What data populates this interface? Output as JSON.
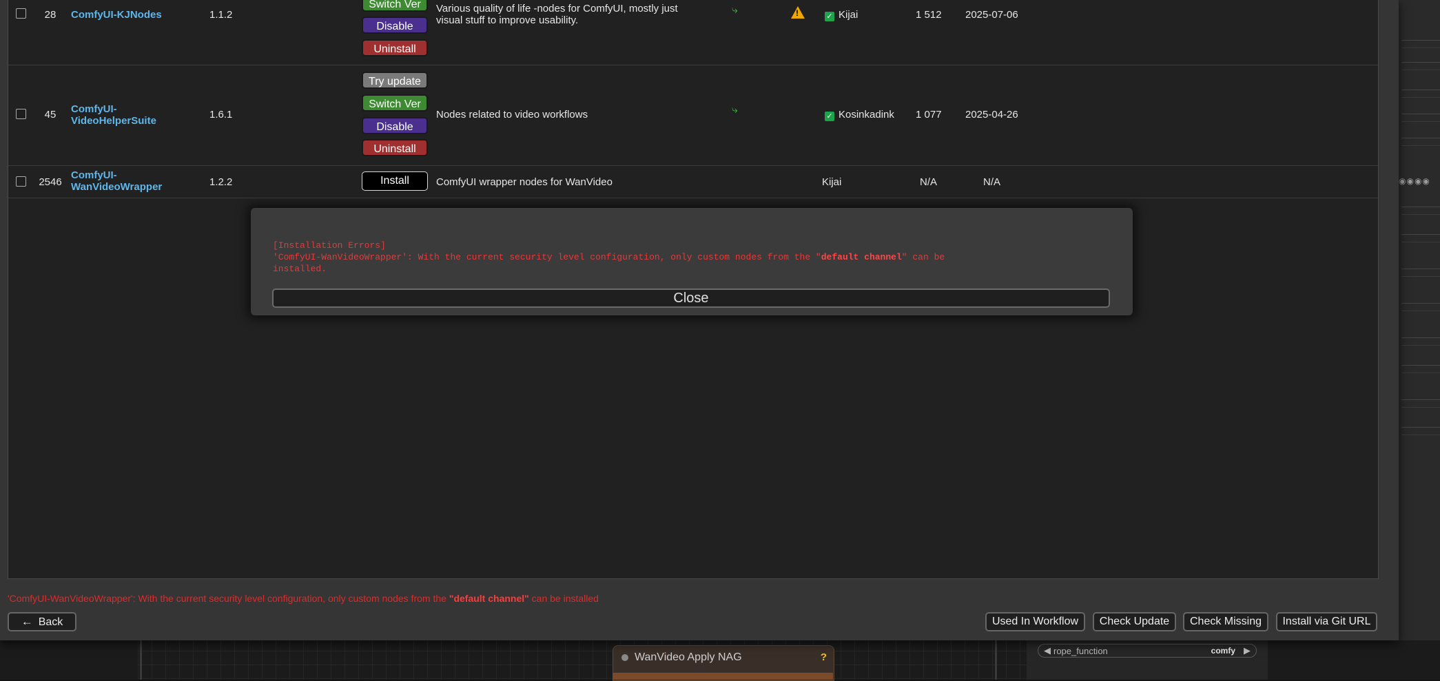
{
  "rows": [
    {
      "id": "28",
      "title": "ComfyUI-KJNodes",
      "version": "1.1.2",
      "buttons": [
        "Switch Ver",
        "Disable",
        "Uninstall"
      ],
      "description": "Various quality of life -nodes for ComfyUI, mostly just visual stuff to improve usability.",
      "author": "Kijai",
      "stars": "1 512",
      "updated": "2025-07-06"
    },
    {
      "id": "45",
      "title": "ComfyUI-VideoHelperSuite",
      "title_line1": "ComfyUI-",
      "title_line2": "VideoHelperSuite",
      "version": "1.6.1",
      "buttons": [
        "Try update",
        "Switch Ver",
        "Disable",
        "Uninstall"
      ],
      "description": "Nodes related to video workflows",
      "author": "Kosinkadink",
      "stars": "1 077",
      "updated": "2025-04-26"
    },
    {
      "id": "2546",
      "title_line1": "ComfyUI-",
      "title_line2": "WanVideoWrapper",
      "version": "1.2.2",
      "buttons": [
        "Install"
      ],
      "description": "ComfyUI wrapper nodes for WanVideo",
      "author": "Kijai",
      "stars": "N/A",
      "updated": "N/A"
    }
  ],
  "dialog": {
    "heading": "[Installation Errors]",
    "line_prefix": "'ComfyUI-WanVideoWrapper': With the current security level configuration, only custom nodes from the \"",
    "line_bold": "default channel",
    "line_suffix": "\" can be\ninstalled.",
    "close_label": "Close"
  },
  "status": {
    "prefix": "'ComfyUI-WanVideoWrapper': With the current security level configuration, only custom nodes from the ",
    "bold": "\"default channel\"",
    "suffix": " can be installed"
  },
  "toolbar": {
    "back_label": "Back",
    "used_in_workflow": "Used In Workflow",
    "check_update": "Check Update",
    "check_missing": "Check Missing",
    "install_git_url": "Install via Git URL"
  },
  "canvas": {
    "node_title": "WanVideo Apply NAG",
    "node_help": "?",
    "widget_name": "rope_function",
    "widget_value": "comfy"
  },
  "colors": {
    "title_link": "#5fb6ea",
    "switch_ver": "#3e8a32",
    "disable": "#4b2f8f",
    "uninstall": "#a02f2f",
    "error_text": "#e23b3b"
  }
}
